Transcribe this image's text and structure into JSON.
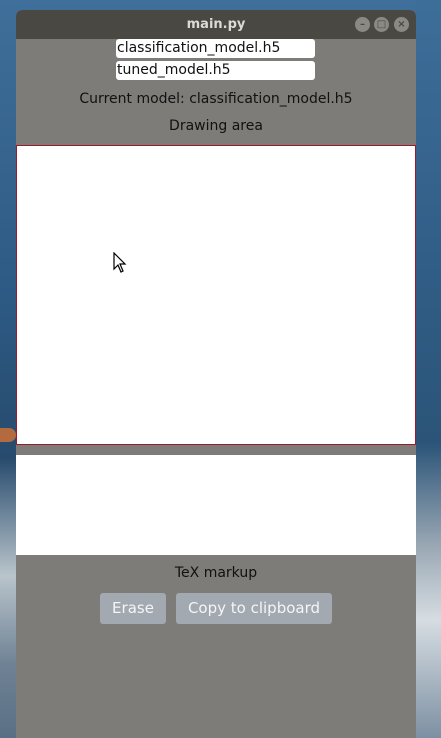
{
  "window": {
    "title": "main.py",
    "controls": {
      "minimize": "minimize-icon",
      "maximize": "maximize-icon",
      "close": "close-icon"
    }
  },
  "models": {
    "items": [
      "classification_model.h5",
      "tuned_model.h5"
    ],
    "current_label": "Current model: classification_model.h5"
  },
  "drawing": {
    "label": "Drawing area",
    "border_color": "#9b1b2a"
  },
  "output": {
    "label": "TeX markup",
    "text": ""
  },
  "buttons": {
    "erase": "Erase",
    "copy": "Copy to clipboard"
  },
  "colors": {
    "window_bg": "#7d7c78",
    "titlebar": "#4a4843",
    "button_bg": "#a3a9b0"
  }
}
